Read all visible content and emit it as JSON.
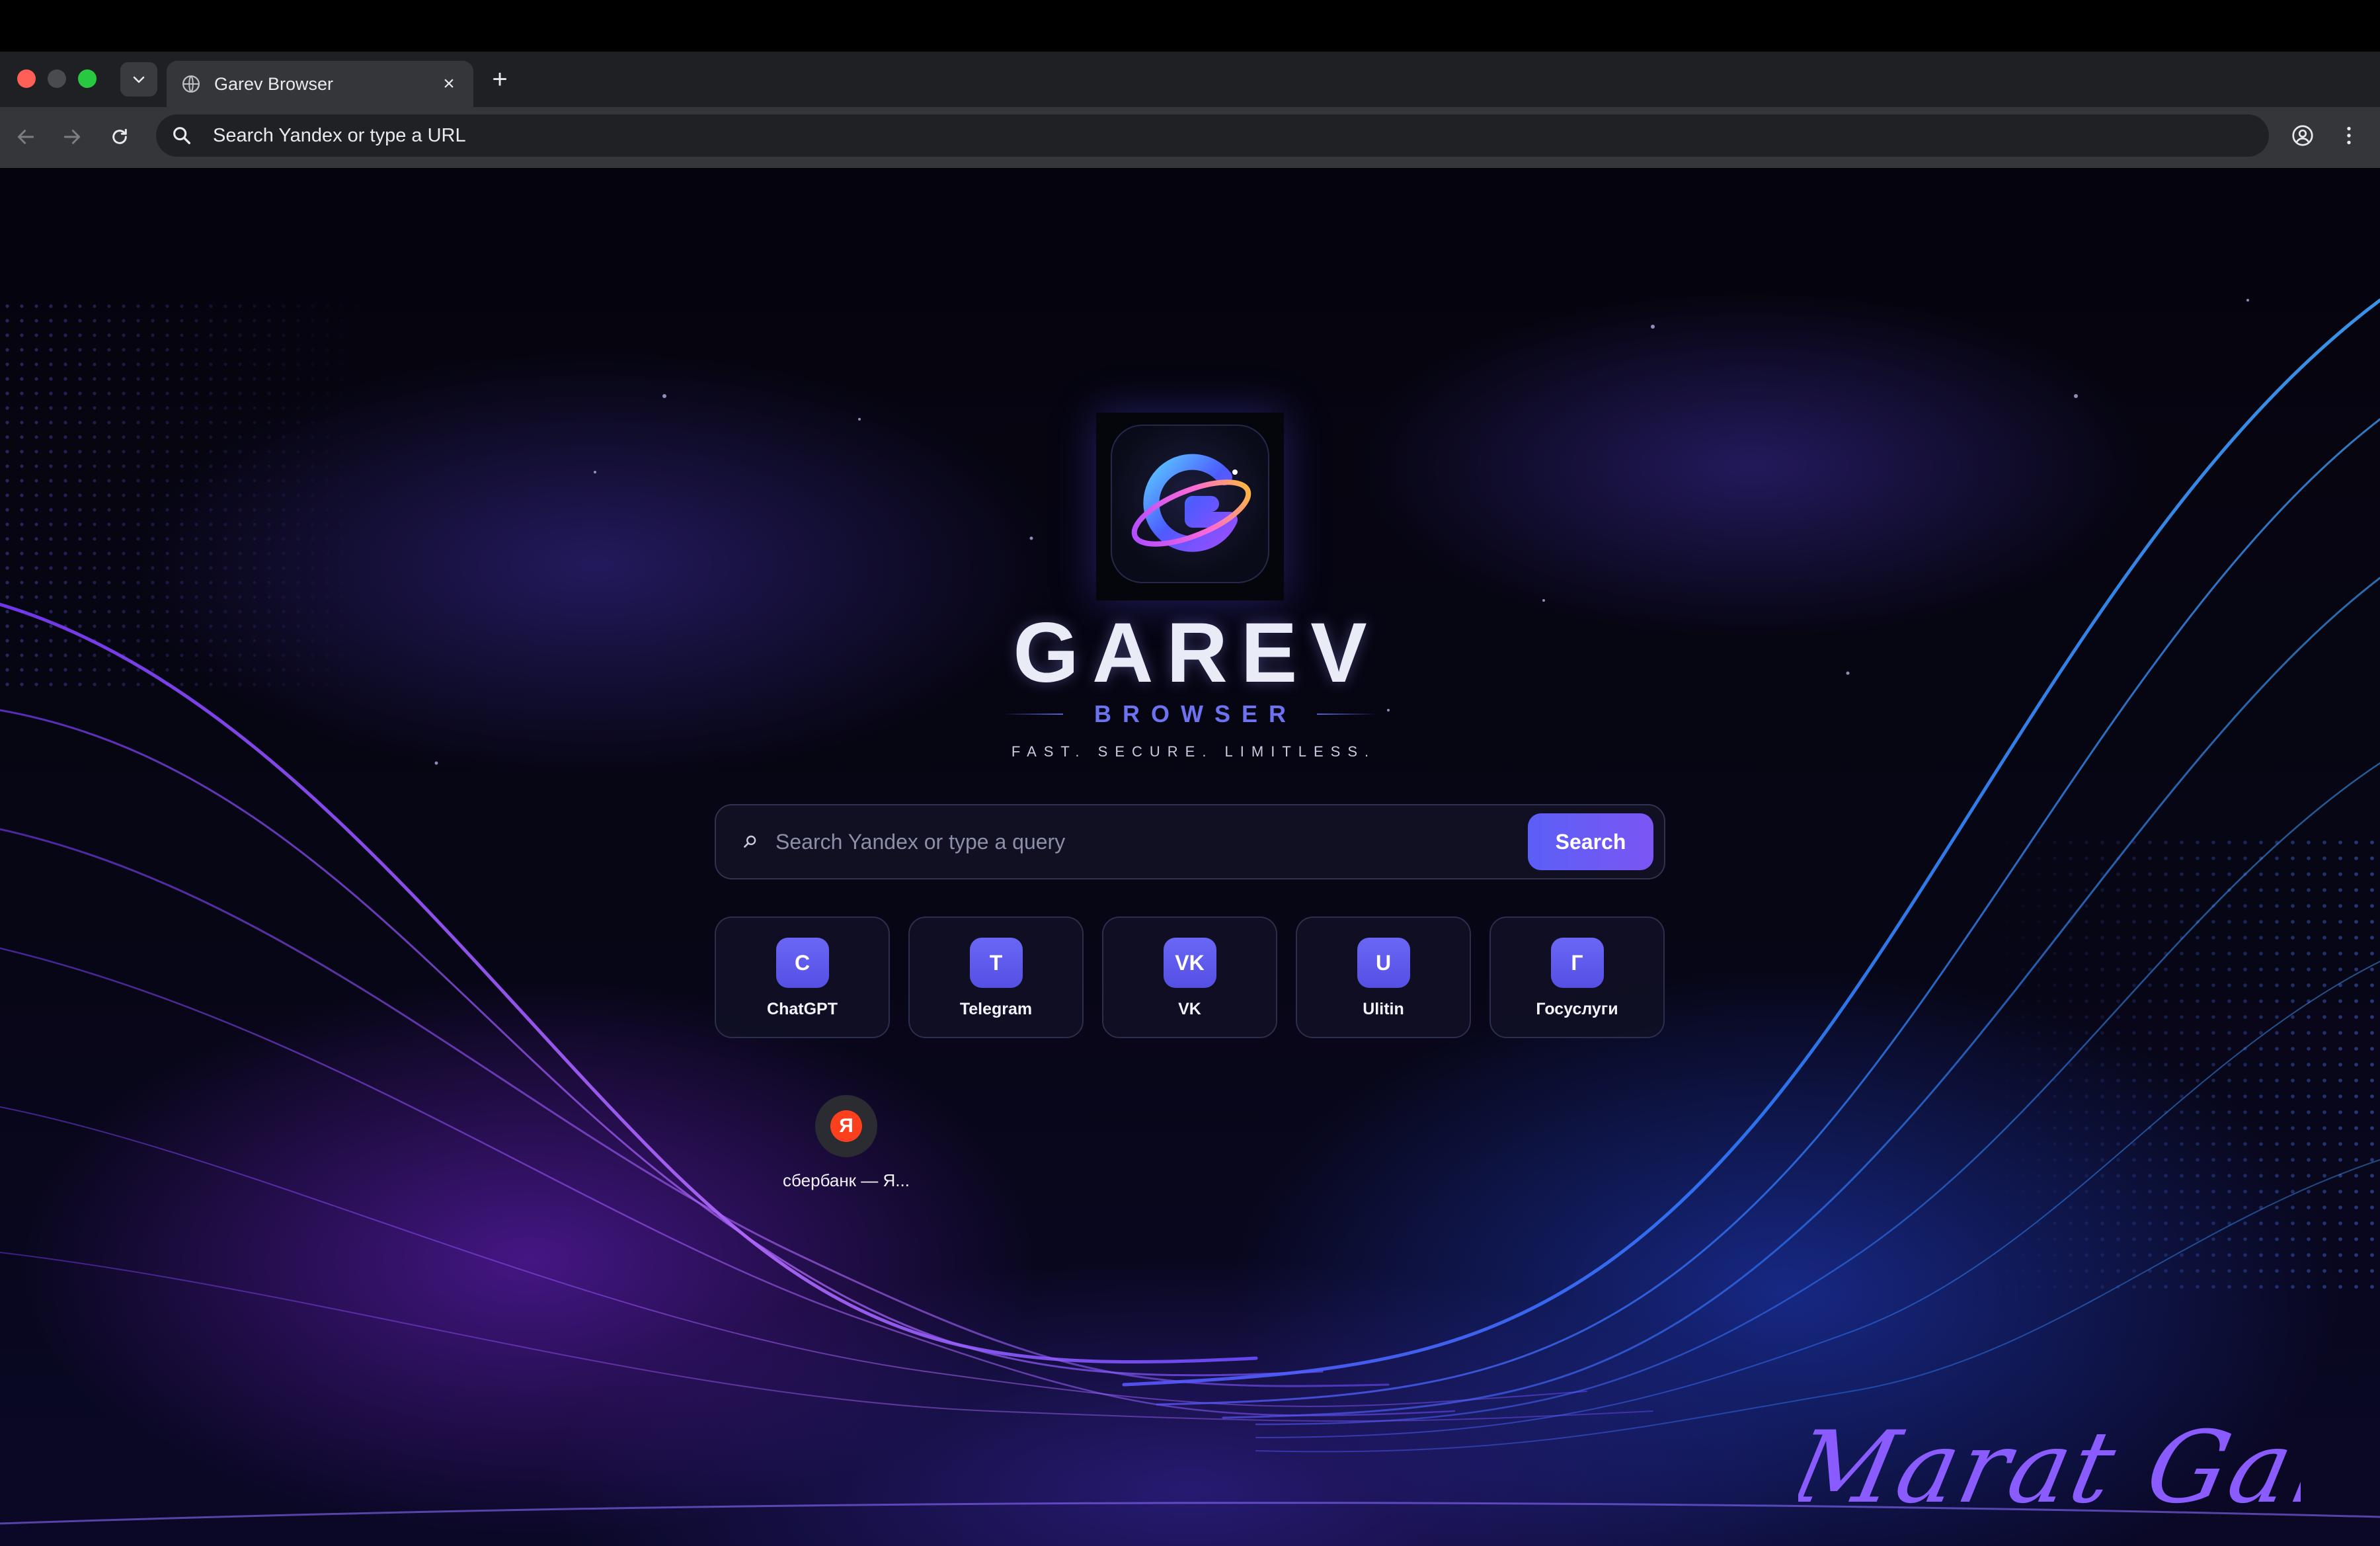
{
  "window": {
    "tab_title": "Garev Browser",
    "tab_close_glyph": "×",
    "new_tab_glyph": "+"
  },
  "toolbar": {
    "omnibox_placeholder": "Search Yandex or type a URL"
  },
  "page": {
    "brand_title": "GAREV",
    "brand_subtitle": "BROWSER",
    "tagline": "FAST. SECURE. LIMITLESS.",
    "search": {
      "placeholder": "Search Yandex or type a query",
      "button_label": "Search"
    },
    "tiles": [
      {
        "badge": "C",
        "label": "ChatGPT"
      },
      {
        "badge": "T",
        "label": "Telegram"
      },
      {
        "badge": "VK",
        "label": "VK"
      },
      {
        "badge": "U",
        "label": "Ulitin"
      },
      {
        "badge": "Г",
        "label": "Госуслуги"
      }
    ],
    "shortcut": {
      "icon_letter": "Я",
      "label": "сбербанк — Я..."
    },
    "signature": "Marat Garev"
  },
  "colors": {
    "accent": "#5b5ff7",
    "tab_bar": "#1f2023",
    "toolbar": "#35363a",
    "yandex_red": "#fc3f1d"
  },
  "icons": [
    "chevron-down-icon",
    "globe-icon",
    "back-arrow-icon",
    "forward-arrow-icon",
    "reload-icon",
    "search-icon",
    "profile-icon",
    "menu-icon",
    "garev-logo-icon",
    "yandex-icon"
  ]
}
